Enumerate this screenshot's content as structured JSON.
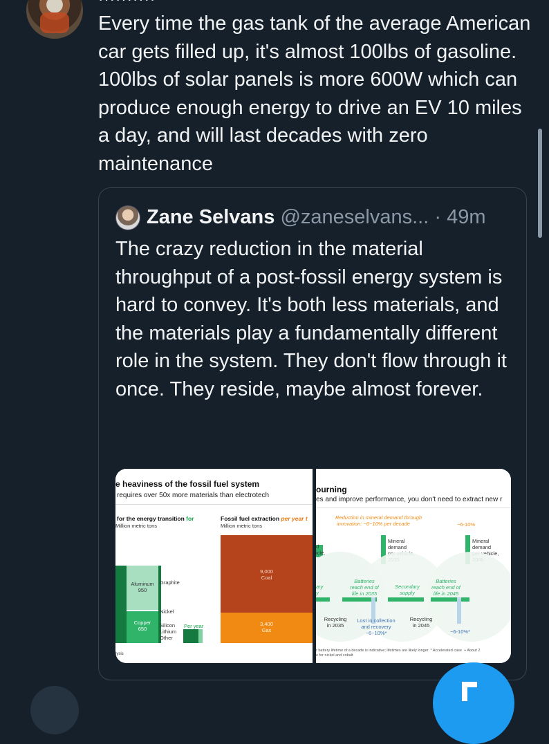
{
  "tweet": {
    "header_fragment": "··········",
    "text": "Every time the gas tank of the average American car gets filled up, it's almost 100lbs of gasoline. 100lbs of solar panels is more 600W which can produce enough energy to drive an EV 10 miles a day, and will last decades with zero maintenance"
  },
  "quote": {
    "name": "Zane Selvans",
    "handle": "@zaneselvans...",
    "separator": "·",
    "time": "49m",
    "text": "The crazy reduction in the material throughput of a post-fossil energy system is hard to convey. It's both less materials, and the materials play a fundamentally different role in the system. They don't flow through it once. They reside, maybe almost forever.",
    "image_left": {
      "title": "e heaviness of the fossil fuel system",
      "subtitle": "requires over 50x more materials than electrotech",
      "col1_heading_a": "for the energy transition",
      "col1_heading_b": "for",
      "col1_unit": "Million metric tons",
      "col2_heading_a": "Fossil fuel extraction",
      "col2_heading_b": "per year",
      "col2_heading_c": "t",
      "col2_unit": "Million metric tons",
      "aluminum": "Aluminum\n950",
      "graphite": "Graphite",
      "nickel": "Nickel",
      "copper": "Copper\n650",
      "silicon": "Silicon",
      "lithium": "Lithium",
      "other": "Other",
      "per_year": "Per year",
      "coal": "9,000\nCoal",
      "gas": "3,400\nGas",
      "footer": "lysis"
    },
    "image_right": {
      "title": "ourning",
      "subtitle": "es and improve performance, you don't need to extract new r",
      "reduction": "Reduction in mineral demand through\ninnovation: −6−10% per decade",
      "pct_right": "−6-10%",
      "mineral_2035": "Mineral\ndemand\nper vehicle,\n2035",
      "mineral_2045": "Mineral\ndemand\nper vehicle,\n2045",
      "left_d": "d\nicle,",
      "left_ary": "ary\ny",
      "batteries_2035": "Batteries\nreach end of\nlife in 2035",
      "secondary": "Secondary\nsupply",
      "batteries_2045": "Batteries\nreach end of\nlife in 2045",
      "recycling_2035": "Recycling\nin 2035",
      "lost": "Lost in collection\nand recovery\n−6−10%*",
      "recycling_2045": "Recycling\nin 2045",
      "pct_bottom": "−6-10%*",
      "footnote": "r battery lifetime of a decade is indicative; lifetimes are likely longer. * Accelerated case  + About 2\ne for nickel and cobalt"
    }
  },
  "colors": {
    "background": "#15202b",
    "text": "#e7e9ea",
    "muted": "#8b98a5",
    "accent": "#1d9bf0",
    "coal": "#b5441c",
    "gas": "#f08a12",
    "green_dark": "#157a3f",
    "green_mid": "#2fb46a",
    "green_light": "#a7dfc0"
  },
  "icons": {
    "fab": "compose-icon"
  }
}
